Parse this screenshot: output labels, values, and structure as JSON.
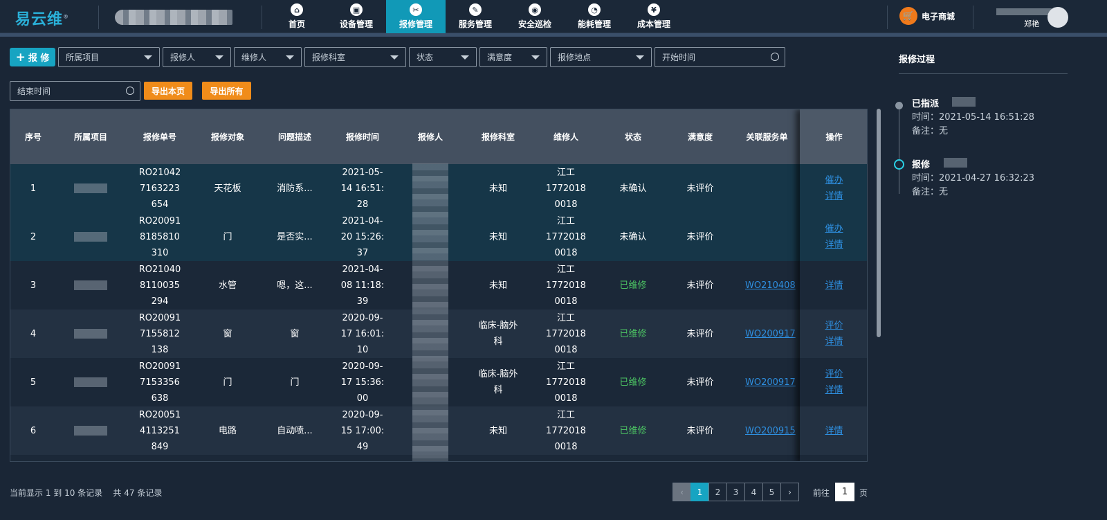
{
  "header": {
    "logo": "易云维",
    "logo_mark": "®",
    "nav": [
      {
        "label": "首页",
        "icon": "home-icon",
        "glyph": "⌂"
      },
      {
        "label": "设备管理",
        "icon": "device-icon",
        "glyph": "▣"
      },
      {
        "label": "报修管理",
        "icon": "repair-icon",
        "glyph": "✂"
      },
      {
        "label": "服务管理",
        "icon": "service-icon",
        "glyph": "✎"
      },
      {
        "label": "安全巡检",
        "icon": "inspect-icon",
        "glyph": "◉"
      },
      {
        "label": "能耗管理",
        "icon": "energy-icon",
        "glyph": "◔"
      },
      {
        "label": "成本管理",
        "icon": "cost-icon",
        "glyph": "¥"
      }
    ],
    "active_nav": 2,
    "mall": "电子商城",
    "user": "郑艳"
  },
  "filters": {
    "add_button": "报 修",
    "project": "所属项目",
    "reporter": "报修人",
    "maintainer": "维修人",
    "department": "报修科室",
    "status": "状态",
    "satisfaction": "满意度",
    "location": "报修地点",
    "start_time": "开始时间",
    "end_time": "结束时间",
    "export_page": "导出本页",
    "export_all": "导出所有"
  },
  "table": {
    "headers": [
      "序号",
      "所属项目",
      "报修单号",
      "报修对象",
      "问题描述",
      "报修时间",
      "报修人",
      "报修科室",
      "维修人",
      "状态",
      "满意度",
      "关联服务单",
      "操作"
    ],
    "rows": [
      {
        "no": "1",
        "order": "RO21042\n7163223\n654",
        "object": "天花板",
        "desc": "消防系...",
        "time": "2021-05-\n14 16:51:\n28",
        "dept": "未知",
        "maint": "江工\n1772018\n0018",
        "status": "未确认",
        "sat": "未评价",
        "wo": "",
        "ops": [
          "催办",
          "详情"
        ]
      },
      {
        "no": "2",
        "order": "RO20091\n8185810\n310",
        "object": "门",
        "desc": "是否实...",
        "time": "2021-04-\n20 15:26:\n37",
        "dept": "未知",
        "maint": "江工\n1772018\n0018",
        "status": "未确认",
        "sat": "未评价",
        "wo": "",
        "ops": [
          "催办",
          "详情"
        ]
      },
      {
        "no": "3",
        "order": "RO21040\n8110035\n294",
        "object": "水管",
        "desc": "嗯，这...",
        "time": "2021-04-\n08 11:18:\n39",
        "dept": "未知",
        "maint": "江工\n1772018\n0018",
        "status": "已维修",
        "sat": "未评价",
        "wo": "WO210408",
        "ops": [
          "详情"
        ]
      },
      {
        "no": "4",
        "order": "RO20091\n7155812\n138",
        "object": "窗",
        "desc": "窗",
        "time": "2020-09-\n17 16:01:\n10",
        "dept": "临床-脑外\n科",
        "maint": "江工\n1772018\n0018",
        "status": "已维修",
        "sat": "未评价",
        "wo": "WO200917",
        "ops": [
          "评价",
          "详情"
        ]
      },
      {
        "no": "5",
        "order": "RO20091\n7153356\n638",
        "object": "门",
        "desc": "门",
        "time": "2020-09-\n17 15:36:\n00",
        "dept": "临床-脑外\n科",
        "maint": "江工\n1772018\n0018",
        "status": "已维修",
        "sat": "未评价",
        "wo": "WO200917",
        "ops": [
          "评价",
          "详情"
        ]
      },
      {
        "no": "6",
        "order": "RO20051\n4113251\n849",
        "object": "电路",
        "desc": "自动喷...",
        "time": "2020-09-\n15 17:00:\n49",
        "dept": "未知",
        "maint": "江工\n1772018\n0018",
        "status": "已维修",
        "sat": "未评价",
        "wo": "WO200915",
        "ops": [
          "详情"
        ]
      }
    ]
  },
  "footer": {
    "info": "当前显示 1 到 10 条记录    共 47 条记录",
    "pages": [
      "1",
      "2",
      "3",
      "4",
      "5"
    ],
    "prev": "‹",
    "next": "›",
    "goto_label": "前往",
    "goto_value": "1",
    "goto_unit": "页"
  },
  "side": {
    "title": "报修过程",
    "events": [
      {
        "title": "已指派",
        "time": "时间：2021-05-14 16:51:28",
        "note": "备注：无"
      },
      {
        "title": "报修",
        "time": "时间：2021-04-27 16:32:23",
        "note": "备注：无"
      }
    ]
  },
  "colors": {
    "accent": "#17a4c2",
    "orange": "#f08c1a",
    "green": "#4cc463",
    "link": "#2e8fe0"
  }
}
